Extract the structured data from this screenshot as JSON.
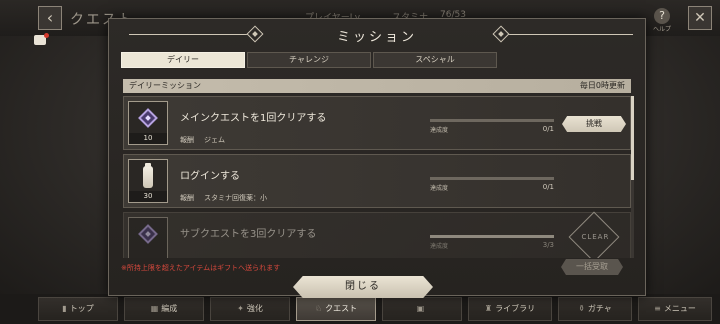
{
  "background": {
    "screen_title": "クエスト",
    "player_label": "プレイヤーLv",
    "stamina_label": "スタミナ",
    "stamina_value": "76/53",
    "help_label": "ヘルプ",
    "back_icon": "arrow-left-icon",
    "close_icon": "close-icon"
  },
  "bottom_nav": [
    {
      "label": "トップ",
      "icon": "home-icon",
      "active": false
    },
    {
      "label": "編成",
      "icon": "team-icon",
      "active": false
    },
    {
      "label": "強化",
      "icon": "upgrade-icon",
      "active": false
    },
    {
      "label": "クエスト",
      "icon": "quest-icon",
      "active": true
    },
    {
      "label": "",
      "icon": "shop-icon",
      "active": false
    },
    {
      "label": "ライブラリ",
      "icon": "library-icon",
      "active": false
    },
    {
      "label": "ガチャ",
      "icon": "gacha-icon",
      "active": false
    },
    {
      "label": "メニュー",
      "icon": "menu-icon",
      "active": false
    }
  ],
  "dialog": {
    "title": "ミッション",
    "tabs": [
      {
        "label": "デイリー",
        "active": true
      },
      {
        "label": "チャレンジ",
        "active": false
      },
      {
        "label": "スペシャル",
        "active": false
      }
    ],
    "section": {
      "title": "デイリーミッション",
      "reset_text": "毎日0時更新"
    },
    "missions": [
      {
        "title": "メインクエストを1回クリアする",
        "reward_label": "報酬",
        "reward": "ジェム",
        "reward_icon": "gem-icon",
        "quantity": "10",
        "progress_label": "達成度",
        "progress": "0/1",
        "progress_fraction": 0,
        "action": "挑戦",
        "cleared": false
      },
      {
        "title": "ログインする",
        "reward_label": "報酬",
        "reward": "スタミナ回復薬：小",
        "reward_icon": "stamina-potion-icon",
        "quantity": "30",
        "progress_label": "達成度",
        "progress": "0/1",
        "progress_fraction": 0,
        "action": "",
        "cleared": false
      },
      {
        "title": "サブクエストを3回クリアする",
        "reward_label": "",
        "reward": "",
        "reward_icon": "gem-icon",
        "quantity": "",
        "progress_label": "達成度",
        "progress": "3/3",
        "progress_fraction": 1,
        "action": "CLEAR",
        "cleared": true
      }
    ],
    "notice": "※所持上限を超えたアイテムはギフトへ送られます",
    "bulk_receive_label": "一括受取",
    "close_label": "閉じる"
  },
  "colors": {
    "accent": "#ece6d6",
    "warning": "#d8493d",
    "panel": "#2d2a27"
  }
}
